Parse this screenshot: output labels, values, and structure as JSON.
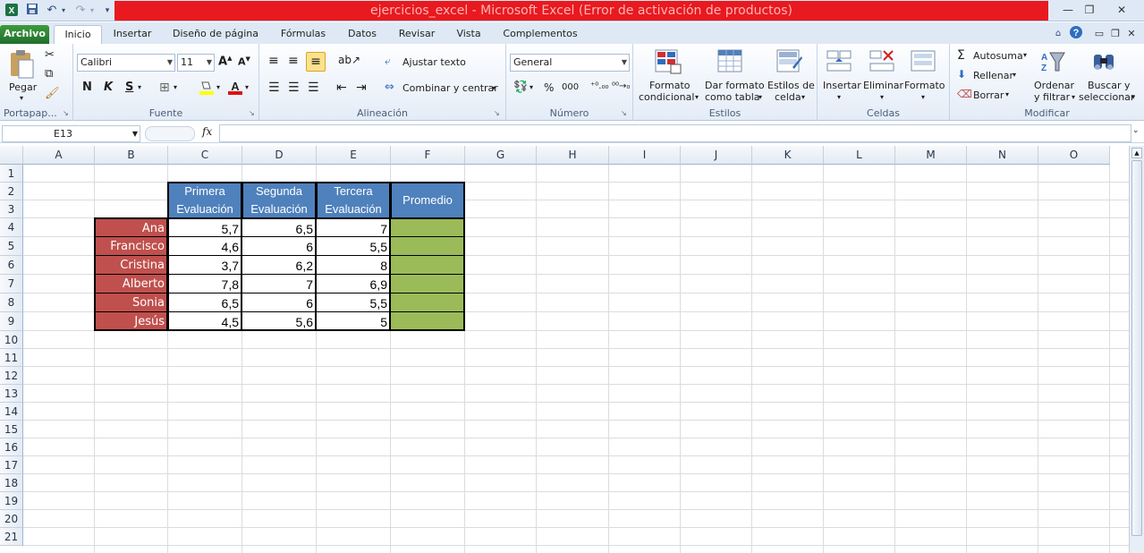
{
  "window": {
    "title": "ejercicios_excel  -  Microsoft Excel (Error de activación de productos)",
    "min_icon": "minimize-icon",
    "max_icon": "restore-icon",
    "close_icon": "close-icon"
  },
  "tabs": [
    "Archivo",
    "Inicio",
    "Insertar",
    "Diseño de página",
    "Fórmulas",
    "Datos",
    "Revisar",
    "Vista",
    "Complementos"
  ],
  "ribbon": {
    "clipboard": {
      "paste": "Pegar",
      "group": "Portapap..."
    },
    "font": {
      "name": "Calibri",
      "size": "11",
      "bold": "N",
      "italic": "K",
      "underline": "S",
      "group": "Fuente"
    },
    "alignment": {
      "wrap": "Ajustar texto",
      "merge": "Combinar y centrar",
      "group": "Alineación"
    },
    "number": {
      "format": "General",
      "percent": "%",
      "thousands": "000",
      "group": "Número"
    },
    "styles": {
      "conditional1": "Formato",
      "conditional2": "condicional",
      "table1": "Dar formato",
      "table2": "como tabla",
      "cell1": "Estilos de",
      "cell2": "celda",
      "group": "Estilos"
    },
    "cells": {
      "insert": "Insertar",
      "delete": "Eliminar",
      "format": "Formato",
      "group": "Celdas"
    },
    "editing": {
      "autosum": "Autosuma",
      "fill": "Rellenar",
      "clear": "Borrar",
      "sort1": "Ordenar",
      "sort2": "y filtrar",
      "find1": "Buscar y",
      "find2": "seleccionar",
      "group": "Modificar"
    }
  },
  "formula_bar": {
    "name_box": "E13",
    "fx": "fx",
    "value": ""
  },
  "columns": [
    "A",
    "B",
    "C",
    "D",
    "E",
    "F",
    "G",
    "H",
    "I",
    "J",
    "K",
    "L",
    "M",
    "N",
    "O"
  ],
  "rows": [
    "1",
    "2",
    "3",
    "4",
    "5",
    "6",
    "7",
    "8",
    "9",
    "10",
    "11",
    "12",
    "13",
    "14",
    "15",
    "16",
    "17",
    "18",
    "19",
    "20",
    "21"
  ],
  "table": {
    "headers": [
      [
        "Primera",
        "Evaluación"
      ],
      [
        "Segunda",
        "Evaluación"
      ],
      [
        "Tercera",
        "Evaluación"
      ],
      [
        "Promedio"
      ]
    ],
    "students": [
      {
        "name": "Ana",
        "c": "5,7",
        "d": "6,5",
        "e": "7"
      },
      {
        "name": "Francisco",
        "c": "4,6",
        "d": "6",
        "e": "5,5"
      },
      {
        "name": "Cristina",
        "c": "3,7",
        "d": "6,2",
        "e": "8"
      },
      {
        "name": "Alberto",
        "c": "7,8",
        "d": "7",
        "e": "6,9"
      },
      {
        "name": "Sonia",
        "c": "6,5",
        "d": "6",
        "e": "5,5"
      },
      {
        "name": "Jesús",
        "c": "4,5",
        "d": "5,6",
        "e": "5"
      }
    ]
  }
}
